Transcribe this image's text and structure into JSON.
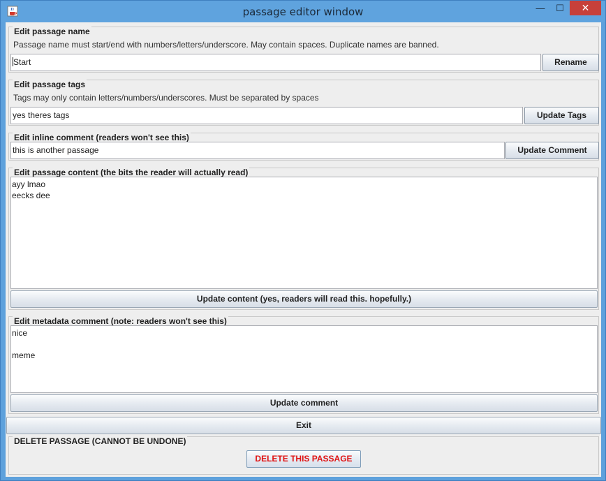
{
  "window": {
    "title": "passage editor window",
    "minimize_glyph": "—",
    "maximize_glyph": "☐",
    "close_glyph": "✕",
    "icon": "java-coffee-icon"
  },
  "passage_name": {
    "legend": "Edit passage name",
    "description": "Passage name must start/end with numbers/letters/underscore. May contain spaces. Duplicate names are banned.",
    "value": "Start",
    "button": "Rename"
  },
  "passage_tags": {
    "legend": "Edit passage tags",
    "description": "Tags may only contain letters/numbers/underscores. Must be separated by spaces",
    "value": "yes theres tags",
    "button": "Update Tags"
  },
  "inline_comment": {
    "legend": "Edit inline comment (readers won't see this)",
    "value": "this is another passage",
    "button": "Update Comment"
  },
  "passage_content": {
    "legend": "Edit passage content (the bits the reader will actually read)",
    "value": "ayy lmao\neecks dee",
    "button": "Update content (yes, readers will read this. hopefully.)"
  },
  "metadata_comment": {
    "legend": "Edit metadata comment (note: readers won't see this)",
    "value": "nice\n\nmeme",
    "button": "Update comment"
  },
  "exit_button": "Exit",
  "delete_section": {
    "legend": "DELETE PASSAGE (CANNOT BE UNDONE)",
    "button": "DELETE THIS PASSAGE",
    "button_color": "#e01414"
  }
}
